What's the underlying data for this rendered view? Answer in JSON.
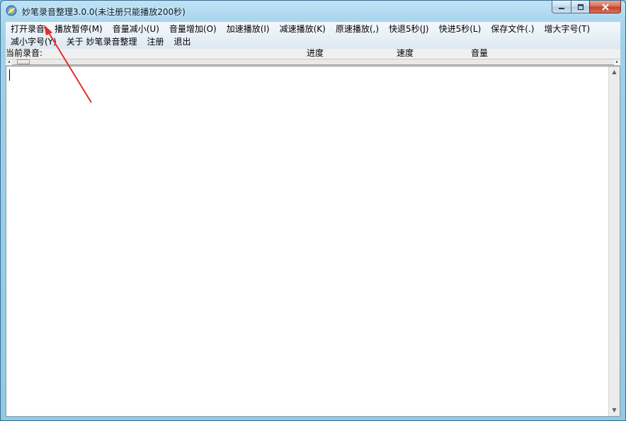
{
  "window": {
    "title": "妙笔录音整理3.0.0(未注册只能播放200秒)",
    "icon": "app-icon",
    "buttons": {
      "minimize": "minimize-icon",
      "maximize": "maximize-icon",
      "close": "close-icon"
    }
  },
  "menu": {
    "row1": [
      "打开录音",
      "播放暂停(M)",
      "音量减小(U)",
      "音量增加(O)",
      "加速播放(I)",
      "减速播放(K)",
      "原速播放(,)",
      "快退5秒(J)",
      "快进5秒(L)",
      "保存文件(.)",
      "增大字号(T)"
    ],
    "row2": [
      "减小字号(Y)",
      "关于 妙笔录音整理",
      "注册",
      "退出"
    ]
  },
  "status": {
    "current_label": "当前录音:",
    "progress_label": "进度",
    "speed_label": "速度",
    "volume_label": "音量"
  },
  "colors": {
    "annotation_arrow": "#e0302a",
    "close_button": "#c2432a",
    "menubar": "#dde8f3"
  }
}
